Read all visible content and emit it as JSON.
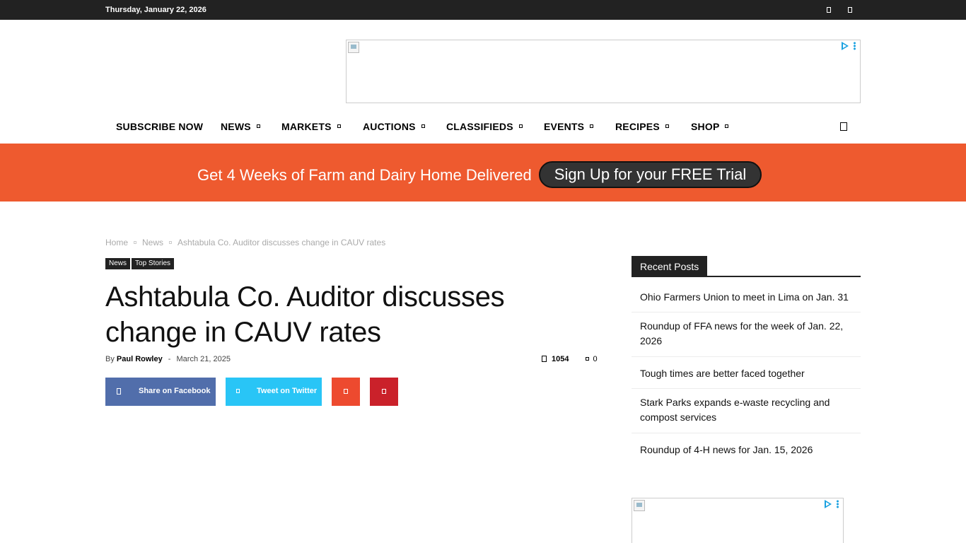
{
  "topbar": {
    "date": "Thursday, January 22, 2026",
    "icons": [
      "social-icon-1",
      "social-icon-2"
    ]
  },
  "nav": {
    "items": [
      {
        "label": "SUBSCRIBE NOW",
        "has_caret": false
      },
      {
        "label": "NEWS",
        "has_caret": true
      },
      {
        "label": "MARKETS",
        "has_caret": true
      },
      {
        "label": "AUCTIONS",
        "has_caret": true
      },
      {
        "label": "CLASSIFIEDS",
        "has_caret": true
      },
      {
        "label": "EVENTS",
        "has_caret": true
      },
      {
        "label": "RECIPES",
        "has_caret": true
      },
      {
        "label": "SHOP",
        "has_caret": true
      }
    ],
    "search_icon": "search-icon"
  },
  "promo": {
    "text": "Get 4 Weeks of Farm and Dairy Home Delivered",
    "button": "Sign Up for your FREE Trial",
    "bg_color": "#ee5a2f"
  },
  "breadcrumb": [
    "Home",
    "News",
    "Ashtabula Co. Auditor discusses change in CAUV rates"
  ],
  "tags": [
    "News",
    "Top Stories"
  ],
  "article": {
    "title": "Ashtabula Co. Auditor discusses change in CAUV rates",
    "by": "By",
    "author": "Paul Rowley",
    "separator": "-",
    "date": "March 21, 2025",
    "views": "1054",
    "comments": "0"
  },
  "share": {
    "facebook": "Share on Facebook",
    "twitter": "Tweet on Twitter",
    "colors": {
      "facebook": "#516eab",
      "twitter": "#29c5f6",
      "mix": "#ed4a2f",
      "pinterest": "#ca212a"
    }
  },
  "sidebar": {
    "heading": "Recent Posts",
    "posts": [
      "Ohio Farmers Union to meet in Lima on Jan. 31",
      "Roundup of FFA news for the week of Jan. 22, 2026",
      "Tough times are better faced together",
      "Stark Parks expands e-waste recycling and compost services",
      "Roundup of 4-H news for Jan. 15, 2026"
    ]
  }
}
